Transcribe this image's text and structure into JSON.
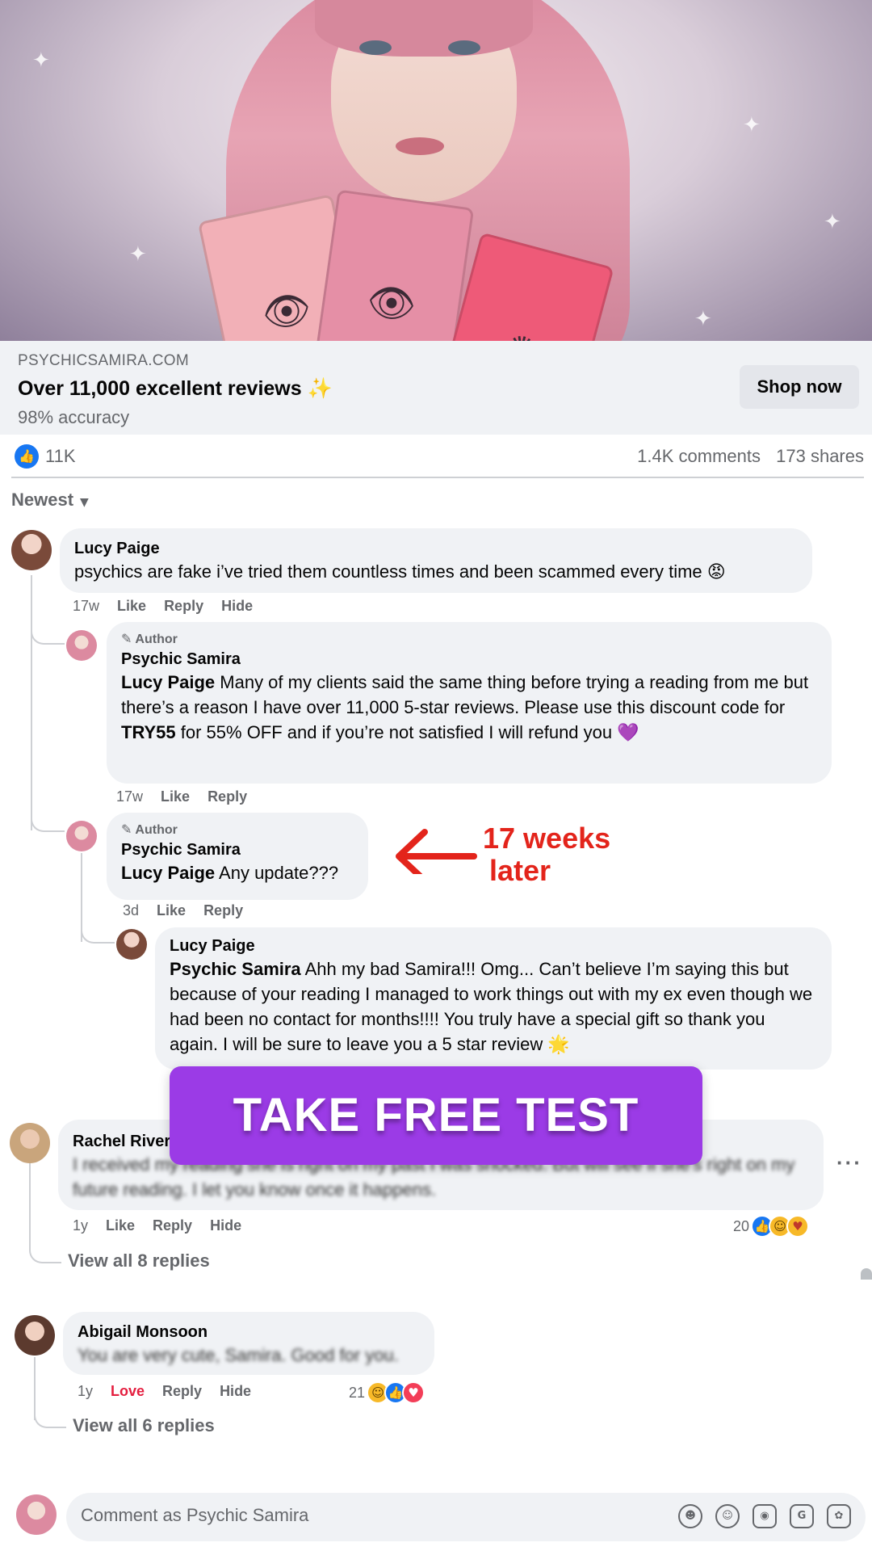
{
  "ad": {
    "domain": "PSYCHICSAMIRA.COM",
    "title": "Over 11,000 excellent reviews",
    "title_emoji": "✨",
    "subtitle": "98% accuracy",
    "cta_label": "Shop now"
  },
  "stats": {
    "likes": "11K",
    "comments": "1.4K comments",
    "shares": "173 shares"
  },
  "sort": {
    "label": "Newest"
  },
  "comments": [
    {
      "name": "Lucy Paige",
      "text": "psychics are fake i’ve tried them countless times and been scammed every time",
      "emoji": "😡",
      "time": "17w",
      "actions": [
        "Like",
        "Reply",
        "Hide"
      ]
    },
    {
      "author_tag": "Author",
      "name": "Psychic Samira",
      "mention": "Lucy Paige",
      "text_a": " Many of my clients said the same thing before trying a reading from me but there’s a reason I have over 11,000 5-star reviews. Please use this discount code for ",
      "code": "TRY55",
      "text_b": " for 55% OFF and if you’re not satisfied I will refund you",
      "emoji": "💜",
      "time": "17w",
      "actions": [
        "Like",
        "Reply"
      ]
    },
    {
      "author_tag": "Author",
      "name": "Psychic Samira",
      "mention": "Lucy Paige",
      "text": " Any update???",
      "time": "3d",
      "actions": [
        "Like",
        "Reply"
      ]
    },
    {
      "name": "Lucy Paige",
      "mention": "Psychic Samira",
      "text": " Ahh my bad Samira!!! Omg... Can’t believe I’m saying this but because of your reading I managed to work things out with my ex even though we had been no contact for months!!!! You truly have a special gift so thank you again. I will be sure to leave you a 5 star review",
      "emoji": "🌟"
    },
    {
      "name": "Rachel Rivera",
      "text": "I received my reading she is right on my past I was shocked. But will see if she's right on my future reading. I let you know once it happens.",
      "time": "1y",
      "actions": [
        "Like",
        "Reply",
        "Hide"
      ],
      "reaction_count": "20",
      "view_replies": "View all 8 replies"
    },
    {
      "name": "Abigail Monsoon",
      "text": "You are very cute, Samira. Good for you.",
      "time": "1y",
      "actions": [
        "Love",
        "Reply",
        "Hide"
      ],
      "reaction_count": "21",
      "view_replies": "View all 6 replies"
    }
  ],
  "annotation": {
    "line1": "17 weeks",
    "line2": "later",
    "color": "#e3241b"
  },
  "overlay_cta": {
    "label": "TAKE FREE TEST",
    "color": "#9b3be6"
  },
  "composer": {
    "placeholder": "Comment as Psychic Samira"
  },
  "colors": {
    "like_blue": "#1877f2",
    "bubble": "#f0f2f5",
    "muted": "#65676b"
  }
}
